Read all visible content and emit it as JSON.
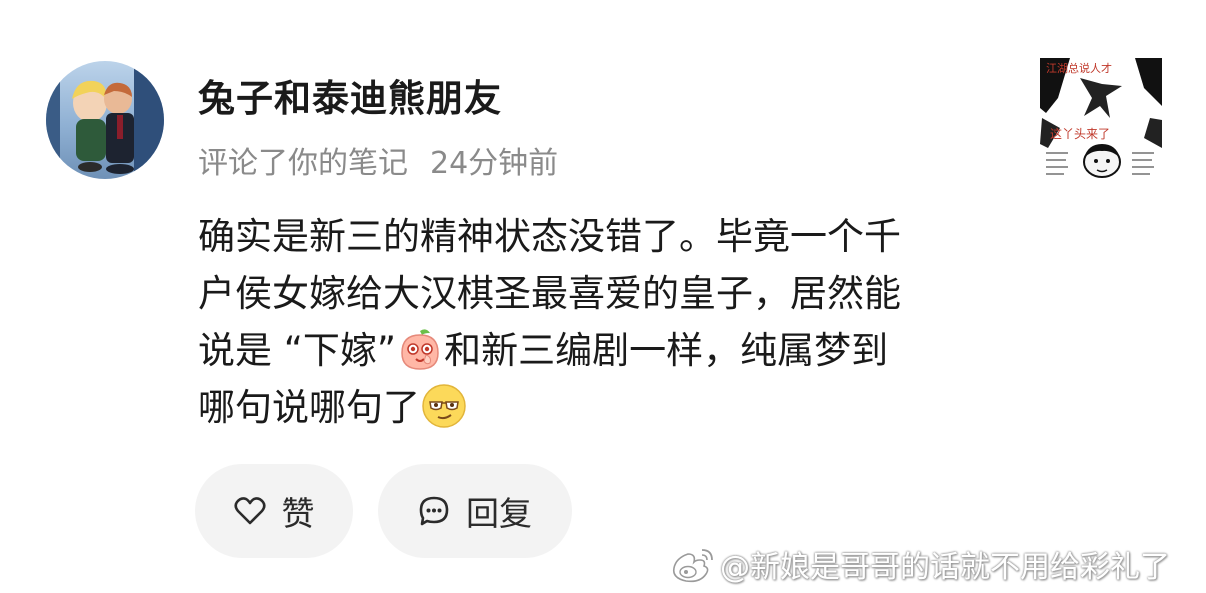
{
  "comment_card": {
    "username": "兔子和泰迪熊朋友",
    "action": "评论了你的笔记",
    "time": "24分钟前",
    "text_lines": [
      "确实是新三的精神状态没错了。毕竟一个千",
      "户侯女嫁给大汉棋圣最喜爱的皇子，居然能",
      "说是 “下嫁”",
      "和新三编剧一样，纯属梦到",
      "哪句说哪句了"
    ],
    "emojis": [
      "peach-emoji",
      "smug-glasses-emoji"
    ]
  },
  "actions": {
    "like_label": "赞",
    "reply_label": "回复"
  },
  "thumbnail": {
    "top_text": "江湖总说人才",
    "middle_text": "这丫头来了",
    "icon": "meme-thumbnail"
  },
  "watermark": {
    "text": "@新娘是哥哥的话就不用给彩礼了",
    "icon": "weibo-icon"
  },
  "colors": {
    "text_primary": "#1a1a1a",
    "text_secondary": "#8a8a8a",
    "button_bg": "#f3f3f3"
  }
}
